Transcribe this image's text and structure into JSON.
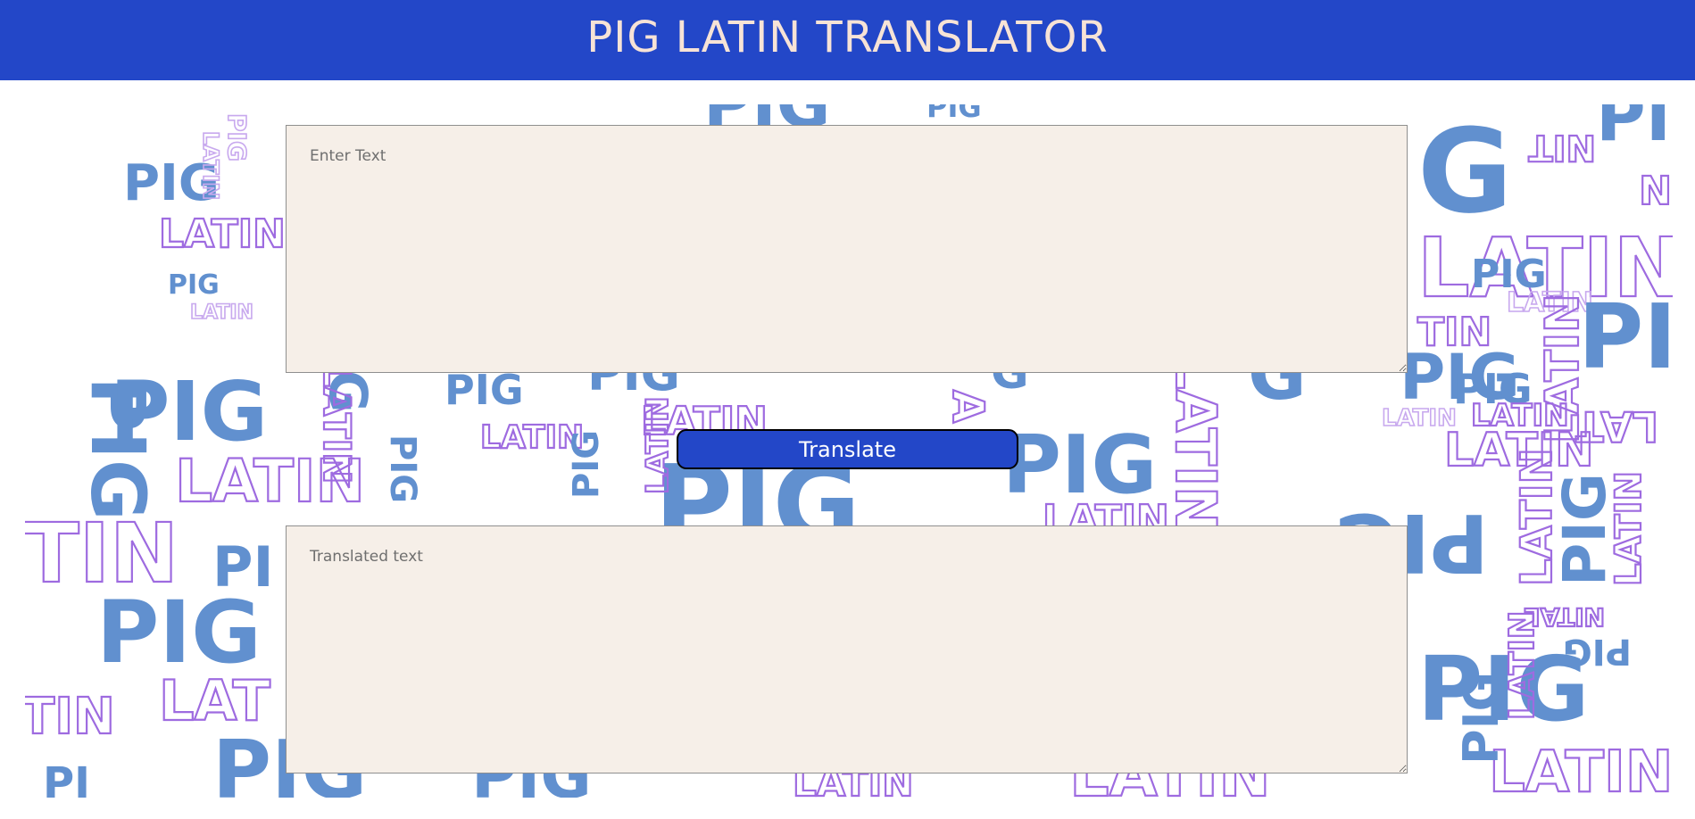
{
  "header": {
    "title": "PIG LATIN TRANSLATOR"
  },
  "background": {
    "words": [
      "PIG",
      "LATIN"
    ],
    "colors": {
      "solid": "#6190cf",
      "outline": "#9e6be0",
      "outline_light": "#c8a9ee"
    }
  },
  "input": {
    "placeholder": "Enter Text",
    "value": ""
  },
  "translate_button": {
    "label": "Translate"
  },
  "output": {
    "placeholder": "Translated text",
    "value": ""
  },
  "colors": {
    "header_bg": "#2347c8",
    "header_text": "#f7e3d6",
    "textarea_bg": "#f6efe8",
    "button_bg": "#2347c8",
    "button_text": "#ffffff"
  }
}
